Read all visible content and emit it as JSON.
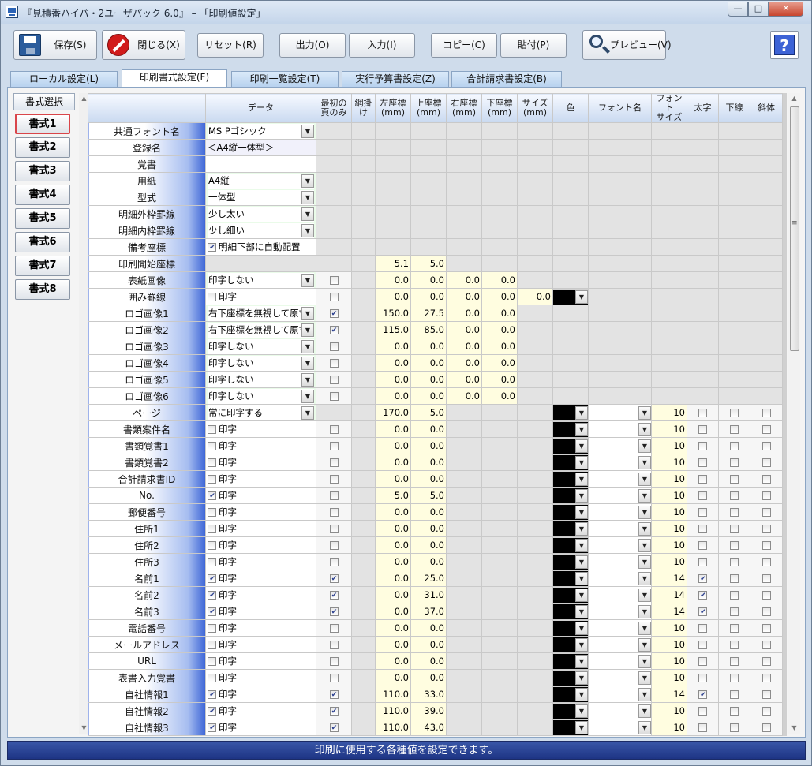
{
  "window": {
    "title": "『見積番ハイパ・2ユーザパック 6.0』 – 「印刷値設定」",
    "min": "—",
    "max": "□",
    "close": "✕"
  },
  "toolbar": {
    "save": "保存(S)",
    "close": "閉じる(X)",
    "reset": "リセット(R)",
    "output": "出力(O)",
    "input": "入力(I)",
    "copy": "コピー(C)",
    "paste": "貼付(P)",
    "preview": "プレビュー(V)",
    "help": "?"
  },
  "tabs": [
    "ローカル設定(L)",
    "印刷書式設定(F)",
    "印刷一覧設定(T)",
    "実行予算書設定(Z)",
    "合計請求書設定(B)"
  ],
  "styles": {
    "header": "書式選択",
    "items": [
      "書式1",
      "書式2",
      "書式3",
      "書式4",
      "書式5",
      "書式6",
      "書式7",
      "書式8"
    ]
  },
  "columns": [
    "データ",
    "最初の\n頁のみ",
    "網掛け",
    "左座標\n(mm)",
    "上座標\n(mm)",
    "右座標\n(mm)",
    "下座標\n(mm)",
    "サイズ\n(mm)",
    "色",
    "フォント名",
    "フォント\nサイズ",
    "太字",
    "下線",
    "斜体"
  ],
  "check_label": "印字",
  "config_rows": [
    {
      "label": "共通フォント名",
      "value": "MS Pゴシック"
    },
    {
      "label": "登録名",
      "value": "＜A4縦一体型＞"
    },
    {
      "label": "覚書",
      "value": ""
    },
    {
      "label": "用紙",
      "value": "A4縦"
    },
    {
      "label": "型式",
      "value": "一体型"
    },
    {
      "label": "明細外枠罫線",
      "value": "少し太い"
    },
    {
      "label": "明細内枠罫線",
      "value": "少し細い"
    },
    {
      "label": "備考座標",
      "value": "明細下部に自動配置"
    }
  ],
  "coord_rows": [
    {
      "label": "印刷開始座標",
      "left": "5.1",
      "top": "5.0"
    },
    {
      "label": "表紙画像",
      "value": "印字しない",
      "left": "0.0",
      "top": "0.0",
      "right": "0.0",
      "bottom": "0.0"
    },
    {
      "label": "囲み罫線",
      "left": "0.0",
      "top": "0.0",
      "right": "0.0",
      "bottom": "0.0",
      "size": "0.0"
    },
    {
      "label": "ロゴ画像1",
      "value": "右下座標を無視して原寸",
      "left": "150.0",
      "top": "27.5",
      "right": "0.0",
      "bottom": "0.0"
    },
    {
      "label": "ロゴ画像2",
      "value": "右下座標を無視して原寸",
      "left": "115.0",
      "top": "85.0",
      "right": "0.0",
      "bottom": "0.0"
    },
    {
      "label": "ロゴ画像3",
      "value": "印字しない",
      "left": "0.0",
      "top": "0.0",
      "right": "0.0",
      "bottom": "0.0"
    },
    {
      "label": "ロゴ画像4",
      "value": "印字しない",
      "left": "0.0",
      "top": "0.0",
      "right": "0.0",
      "bottom": "0.0"
    },
    {
      "label": "ロゴ画像5",
      "value": "印字しない",
      "left": "0.0",
      "top": "0.0",
      "right": "0.0",
      "bottom": "0.0"
    },
    {
      "label": "ロゴ画像6",
      "value": "印字しない",
      "left": "0.0",
      "top": "0.0",
      "right": "0.0",
      "bottom": "0.0"
    }
  ],
  "field_rows": [
    {
      "label": "ページ",
      "value": "常に印字する",
      "left": "170.0",
      "top": "5.0",
      "fsize": "10"
    },
    {
      "label": "書類案件名",
      "left": "0.0",
      "top": "0.0",
      "fsize": "10"
    },
    {
      "label": "書類覚書1",
      "left": "0.0",
      "top": "0.0",
      "fsize": "10"
    },
    {
      "label": "書類覚書2",
      "left": "0.0",
      "top": "0.0",
      "fsize": "10"
    },
    {
      "label": "合計請求書ID",
      "left": "0.0",
      "top": "0.0",
      "fsize": "10"
    },
    {
      "label": "No.",
      "left": "5.0",
      "top": "5.0",
      "fsize": "10",
      "print": true
    },
    {
      "label": "郵便番号",
      "left": "0.0",
      "top": "0.0",
      "fsize": "10"
    },
    {
      "label": "住所1",
      "left": "0.0",
      "top": "0.0",
      "fsize": "10"
    },
    {
      "label": "住所2",
      "left": "0.0",
      "top": "0.0",
      "fsize": "10"
    },
    {
      "label": "住所3",
      "left": "0.0",
      "top": "0.0",
      "fsize": "10"
    },
    {
      "label": "名前1",
      "left": "0.0",
      "top": "25.0",
      "fsize": "14",
      "print": true,
      "first": true,
      "bold": true
    },
    {
      "label": "名前2",
      "left": "0.0",
      "top": "31.0",
      "fsize": "14",
      "print": true,
      "first": true,
      "bold": true
    },
    {
      "label": "名前3",
      "left": "0.0",
      "top": "37.0",
      "fsize": "14",
      "print": true,
      "first": true,
      "bold": true
    },
    {
      "label": "電話番号",
      "left": "0.0",
      "top": "0.0",
      "fsize": "10"
    },
    {
      "label": "メールアドレス",
      "left": "0.0",
      "top": "0.0",
      "fsize": "10"
    },
    {
      "label": "URL",
      "left": "0.0",
      "top": "0.0",
      "fsize": "10"
    },
    {
      "label": "表書入力覚書",
      "left": "0.0",
      "top": "0.0",
      "fsize": "10"
    },
    {
      "label": "自社情報1",
      "left": "110.0",
      "top": "33.0",
      "fsize": "14",
      "print": true,
      "first": true,
      "bold": true
    },
    {
      "label": "自社情報2",
      "left": "110.0",
      "top": "39.0",
      "fsize": "10",
      "print": true,
      "first": true
    },
    {
      "label": "自社情報3",
      "left": "110.0",
      "top": "43.0",
      "fsize": "10",
      "print": true,
      "first": true
    }
  ],
  "status": "印刷に使用する各種値を設定できます。"
}
